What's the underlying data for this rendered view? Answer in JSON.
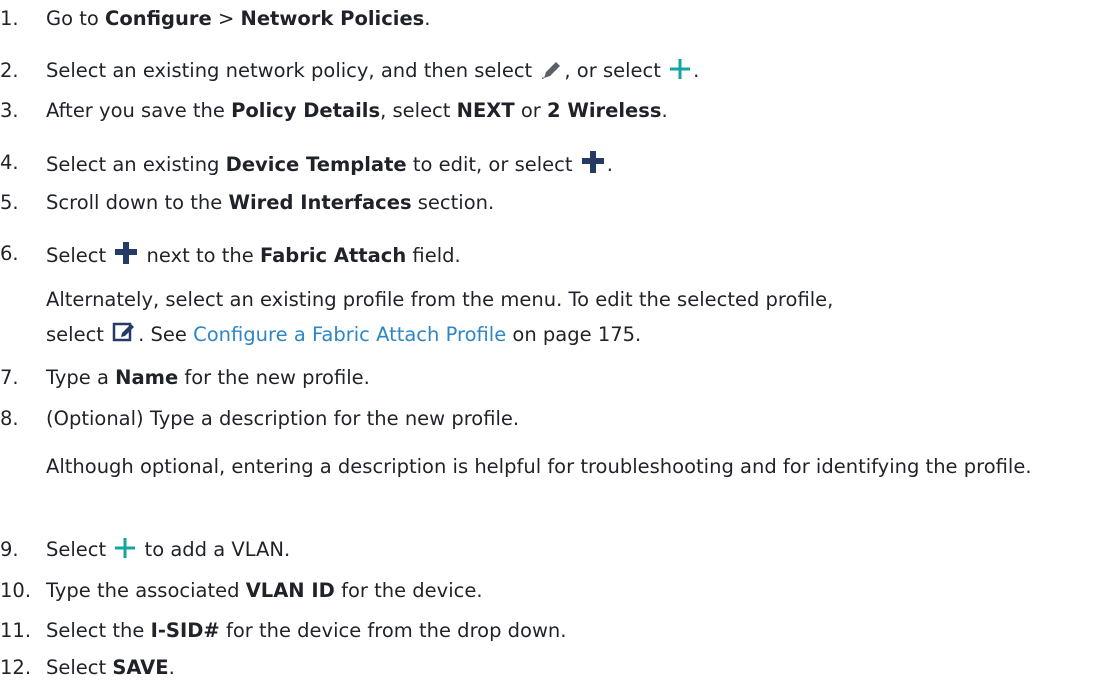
{
  "steps": [
    {
      "num": "1.",
      "a": "Go to ",
      "b1": "Configure",
      "c": " > ",
      "b2": "Network Policies",
      "d": "."
    },
    {
      "num": "2.",
      "a": "Select an existing network policy, and then select ",
      "b": ", or select ",
      "c": "."
    },
    {
      "num": "3.",
      "a": "After you save the ",
      "b1": "Policy Details",
      "c": ", select ",
      "b2": "NEXT",
      "d": " or ",
      "b3": "2 Wireless",
      "e": "."
    },
    {
      "num": "4.",
      "a": "Select an existing ",
      "b1": "Device Template",
      "c": " to edit, or select ",
      "d": "."
    },
    {
      "num": "5.",
      "a": "Scroll down to the ",
      "b1": "Wired Interfaces",
      "c": " section."
    },
    {
      "num": "6.",
      "a": "Select ",
      "c": " next to the ",
      "b1": "Fabric Attach",
      "d": " field."
    },
    {
      "num": "7.",
      "a": "Type a ",
      "b1": "Name",
      "c": " for the new profile."
    },
    {
      "num": "8.",
      "a": "(Optional) Type a description for the new profile."
    },
    {
      "num": "9.",
      "a": "Select ",
      "c": " to add a VLAN."
    },
    {
      "num": "10.",
      "a": "Type the associated ",
      "b1": "VLAN ID",
      "c": " for the device."
    },
    {
      "num": "11.",
      "a": "Select the ",
      "b1": "I-SID#",
      "c": " for the device from the drop down."
    },
    {
      "num": "12.",
      "a": "Select ",
      "b1": "SAVE",
      "c": "."
    }
  ],
  "notes": {
    "step6_line1": "Alternately, select an existing profile from the menu. To edit the selected profile,",
    "step6_line2_a": "select ",
    "step6_line2_b": ". See ",
    "step6_link": "Configure a Fabric Attach Profile",
    "step6_line2_c": " on page 175.",
    "step8": "Although optional, entering a description is helpful for troubleshooting and for identifying the profile."
  },
  "icons": {
    "edit": "pencil-icon",
    "add_teal": "plus-icon",
    "add_dark": "plus-icon",
    "edit_profile": "edit-square-icon"
  },
  "colors": {
    "text": "#1f2329",
    "link": "#2f86c4",
    "teal_plus": "#12a5a1",
    "dark_plus": "#243b66",
    "icon_gray": "#5b5f66"
  }
}
